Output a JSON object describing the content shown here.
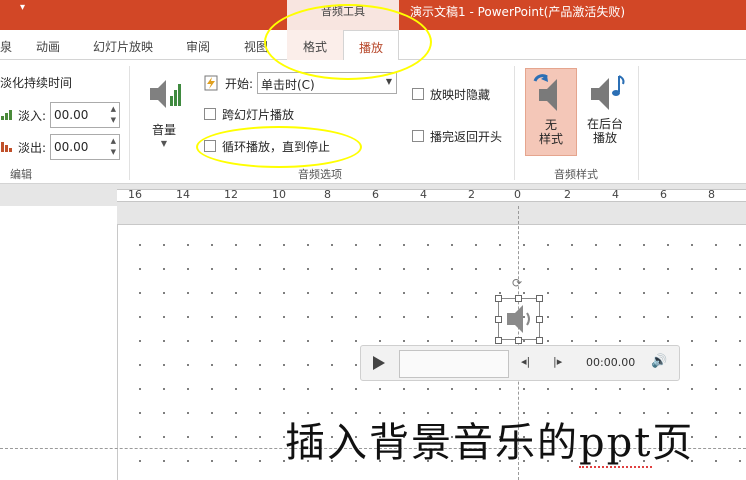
{
  "window": {
    "title": "演示文稿1 - PowerPoint(产品激活失败)",
    "context_header": "音频工具"
  },
  "tabs": {
    "animation": "动画",
    "slideshow": "幻灯片放映",
    "review": "审阅",
    "view": "视图",
    "format": "格式",
    "playback": "播放"
  },
  "ribbon": {
    "editing": {
      "fade_duration_label": "淡化持续时间",
      "fade_in_label": "淡入:",
      "fade_in_value": "00.00",
      "fade_out_label": "淡出:",
      "fade_out_value": "00.00",
      "group_label": "编辑"
    },
    "audio_options": {
      "volume_label": "音量",
      "start_label": "开始:",
      "start_value": "单击时(C)",
      "play_across_slides": "跨幻灯片播放",
      "loop_until_stopped": "循环播放，直到停止",
      "hide_during_show": "放映时隐藏",
      "rewind_after_playing": "播完返回开头",
      "group_label": "音频选项"
    },
    "audio_styles": {
      "no_style_line1": "无",
      "no_style_line2": "样式",
      "play_in_background_line1": "在后台",
      "play_in_background_line2": "播放",
      "group_label": "音频样式"
    }
  },
  "ruler": {
    "ticks": [
      "16",
      "14",
      "12",
      "10",
      "8",
      "6",
      "4",
      "2",
      "0",
      "2",
      "4",
      "6",
      "8"
    ]
  },
  "player": {
    "time": "00:00.00"
  },
  "slide": {
    "title_main": "插入背景音乐的",
    "title_ppt": "ppt",
    "title_end": "页"
  },
  "colors": {
    "title_bar": "#d24726",
    "active_tab": "#b7472a",
    "annotation": "#ffff00"
  }
}
